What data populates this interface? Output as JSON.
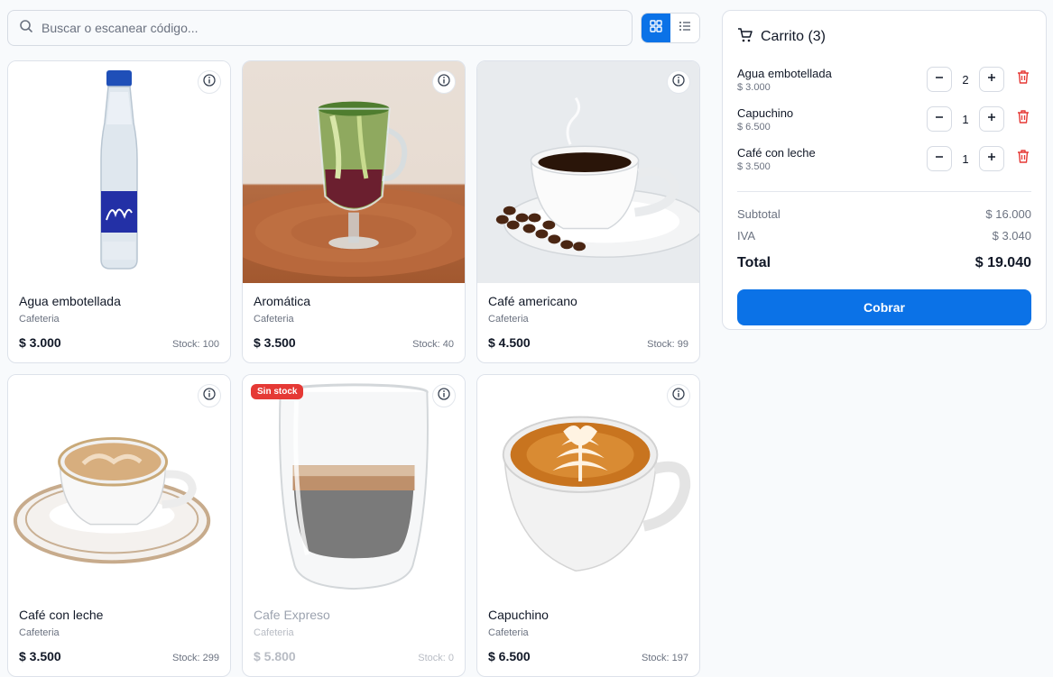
{
  "search": {
    "placeholder": "Buscar o escanear código..."
  },
  "products": [
    {
      "name": "Agua embotellada",
      "category": "Cafeteria",
      "price": "$ 3.000",
      "stock": "Stock: 100"
    },
    {
      "name": "Aromática",
      "category": "Cafeteria",
      "price": "$ 3.500",
      "stock": "Stock: 40"
    },
    {
      "name": "Café americano",
      "category": "Cafeteria",
      "price": "$ 4.500",
      "stock": "Stock: 99"
    },
    {
      "name": "Café con leche",
      "category": "Cafeteria",
      "price": "$ 3.500",
      "stock": "Stock: 299"
    },
    {
      "name": "Cafe Expreso",
      "category": "Cafeteria",
      "price": "$ 5.800",
      "stock": "Stock: 0",
      "badge": "Sin stock"
    },
    {
      "name": "Capuchino",
      "category": "Cafeteria",
      "price": "$ 6.500",
      "stock": "Stock: 197"
    }
  ],
  "cart": {
    "title": "Carrito (3)",
    "items": [
      {
        "name": "Agua embotellada",
        "price": "$ 3.000",
        "qty": "2"
      },
      {
        "name": "Capuchino",
        "price": "$ 6.500",
        "qty": "1"
      },
      {
        "name": "Café con leche",
        "price": "$ 3.500",
        "qty": "1"
      }
    ],
    "subtotal_label": "Subtotal",
    "subtotal": "$ 16.000",
    "tax_label": "IVA",
    "tax": "$ 3.040",
    "total_label": "Total",
    "total": "$ 19.040",
    "charge_label": "Cobrar"
  },
  "colors": {
    "accent": "#0b72e7",
    "danger": "#e53935"
  }
}
